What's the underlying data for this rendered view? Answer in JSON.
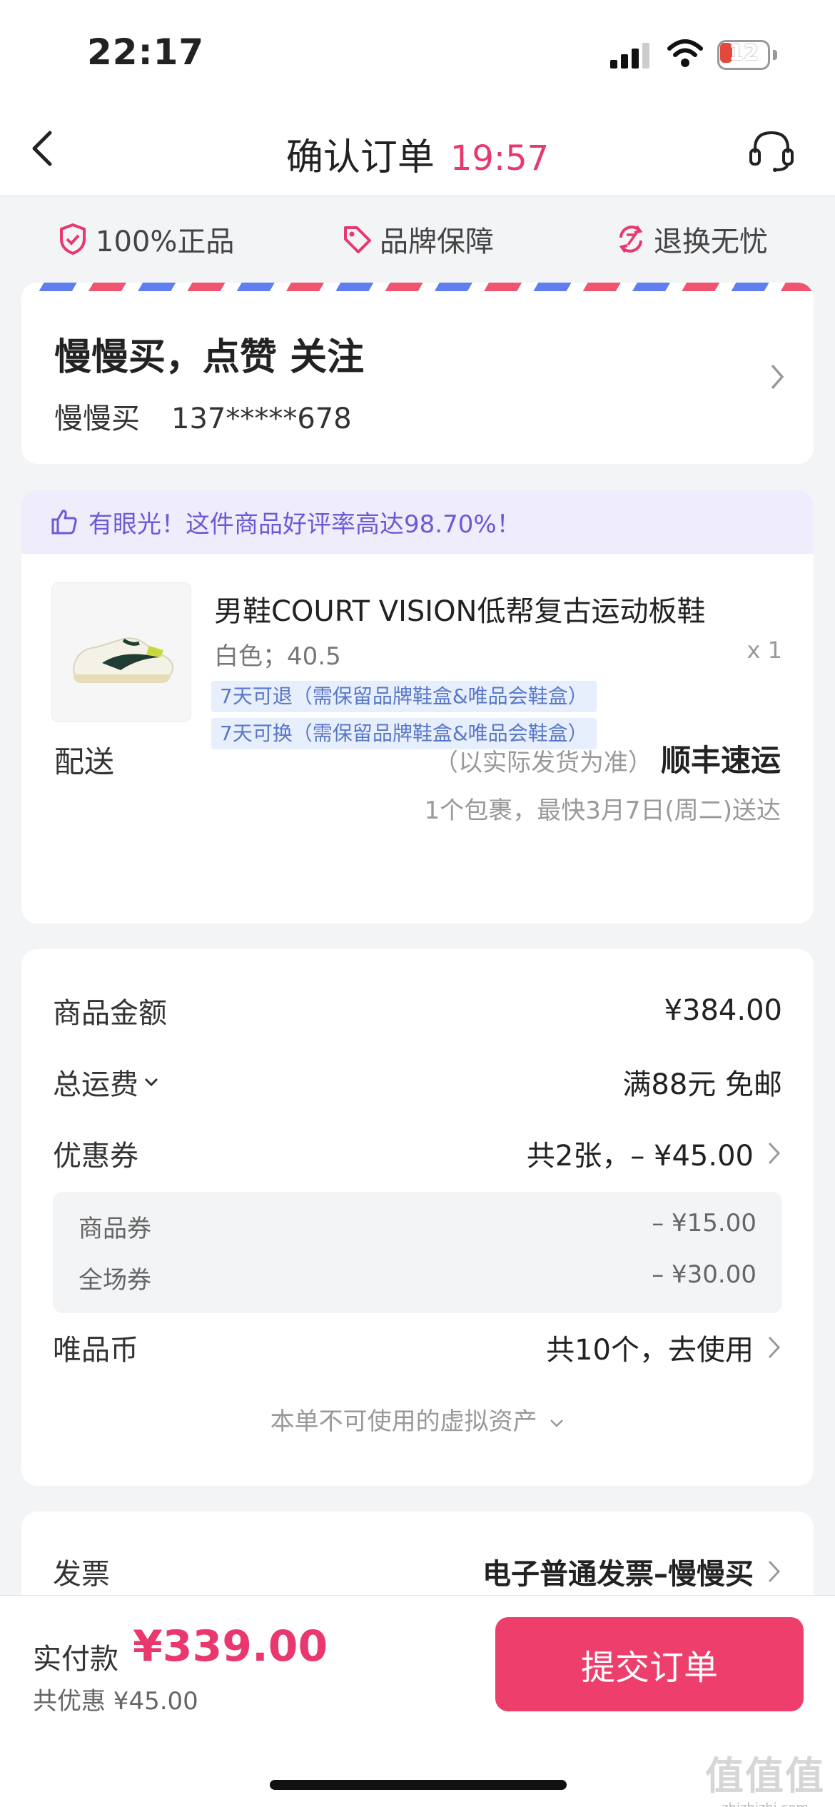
{
  "status_bar": {
    "time": "22:17",
    "battery_level": "12"
  },
  "nav": {
    "title": "确认订单",
    "countdown": "19:57"
  },
  "guarantees": [
    "100%正品",
    "品牌保障",
    "退换无忧"
  ],
  "address": {
    "name": "慢慢买，点赞 关注",
    "receiver": "慢慢买",
    "phone": "137*****678"
  },
  "praise": "有眼光！这件商品好评率高达98.70%！",
  "product": {
    "name": "男鞋COURT VISION低帮复古运动板鞋",
    "spec": "白色；40.5",
    "qty": "x 1",
    "tags": [
      "7天可退（需保留品牌鞋盒&唯品会鞋盒）",
      "7天可换（需保留品牌鞋盒&唯品会鞋盒）"
    ]
  },
  "shipping": {
    "label": "配送",
    "note": "（以实际发货为准）",
    "carrier": "顺丰速运",
    "eta": "1个包裹，最快3月7日(周二)送达"
  },
  "price": {
    "goods_label": "商品金额",
    "goods_value": "¥384.00",
    "freight_label": "总运费",
    "freight_value": "满88元 免邮",
    "coupon_label": "优惠券",
    "coupon_value": "共2张，– ¥45.00",
    "coupons": [
      {
        "label": "商品券",
        "value": "– ¥15.00"
      },
      {
        "label": "全场券",
        "value": "– ¥30.00"
      }
    ],
    "coin_label": "唯品币",
    "coin_value": "共10个，去使用",
    "unused_assets": "本单不可使用的虚拟资产"
  },
  "invoice": {
    "label": "发票",
    "value": "电子普通发票–慢慢买"
  },
  "bottom": {
    "pay_label": "实付款",
    "total": "¥339.00",
    "discount": "共优惠 ¥45.00",
    "submit": "提交订单"
  },
  "watermark": {
    "logo": "值值值",
    "site": "zhizhizhi.com"
  },
  "colors": {
    "accent": "#e8386d",
    "button": "#ee3e6c",
    "praise_text": "#6b5ad6",
    "tag_text": "#5a78c8"
  }
}
